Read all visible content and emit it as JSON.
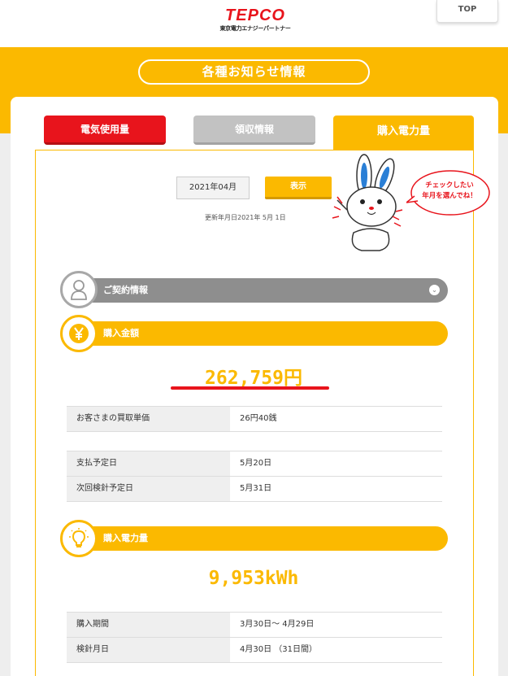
{
  "header": {
    "logo": "TEPCO",
    "logo_sub": "東京電力エナジーパートナー",
    "top_label": "TOP"
  },
  "page_title": "各種お知らせ情報",
  "tabs": [
    {
      "label": "電気使用量"
    },
    {
      "label": "領収情報"
    },
    {
      "label": "購入電力量"
    }
  ],
  "controls": {
    "date_value": "2021年04月",
    "show_label": "表示",
    "updated": "更新年月日2021年 5月 1日"
  },
  "mascot": {
    "bubble_line1": "チェックしたい",
    "bubble_line2": "年月を選んでね！"
  },
  "sections": {
    "contract": {
      "label": "ご契約情報",
      "icon": "person-icon"
    },
    "amount": {
      "label": "購入金額",
      "icon": "yen-icon"
    },
    "power": {
      "label": "購入電力量",
      "icon": "lightbulb-icon"
    }
  },
  "amount": {
    "value": "262,759円"
  },
  "amount_table": [
    {
      "key": "お客さまの買取単価",
      "value": "26円40銭"
    }
  ],
  "schedule_table": [
    {
      "key": "支払予定日",
      "value": "5月20日"
    },
    {
      "key": "次回検針予定日",
      "value": "5月31日"
    }
  ],
  "power": {
    "value": "9,953kWh"
  },
  "power_table": [
    {
      "key": "購入期間",
      "value": "3月30日～ 4月29日"
    },
    {
      "key": "検針月日",
      "value": "4月30日 （31日間）"
    }
  ],
  "colors": {
    "accent": "#fbb900",
    "red": "#e8141c",
    "gray": "#8e8e8e"
  }
}
